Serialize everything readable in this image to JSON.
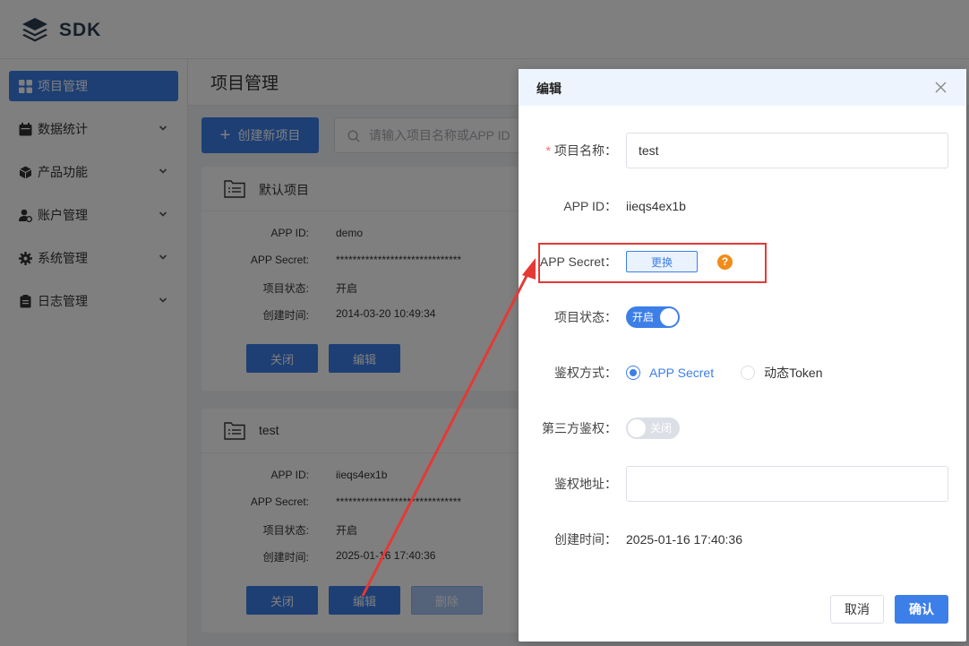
{
  "app": {
    "brand": "SDK"
  },
  "sidebar": {
    "items": [
      {
        "label": "项目管理",
        "icon": "grid-icon",
        "active": true
      },
      {
        "label": "数据统计",
        "icon": "calendar-icon"
      },
      {
        "label": "产品功能",
        "icon": "cube-icon"
      },
      {
        "label": "账户管理",
        "icon": "user-gear-icon"
      },
      {
        "label": "系统管理",
        "icon": "gear-icon"
      },
      {
        "label": "日志管理",
        "icon": "clipboard-icon"
      }
    ]
  },
  "main": {
    "title": "项目管理",
    "create_label": "创建新项目",
    "search_placeholder": "请输入项目名称或APP ID",
    "cards": [
      {
        "name": "默认项目",
        "fields": [
          {
            "label": "APP ID:",
            "value": "demo"
          },
          {
            "label": "APP Secret:",
            "value": "******************************"
          },
          {
            "label": "项目状态:",
            "value": "开启"
          },
          {
            "label": "创建时间:",
            "value": "2014-03-20 10:49:34"
          }
        ],
        "buttons": [
          "关闭",
          "编辑"
        ]
      },
      {
        "name": "test",
        "fields": [
          {
            "label": "APP ID:",
            "value": "iieqs4ex1b"
          },
          {
            "label": "APP Secret:",
            "value": "******************************"
          },
          {
            "label": "项目状态:",
            "value": "开启"
          },
          {
            "label": "创建时间:",
            "value": "2025-01-16 17:40:36"
          }
        ],
        "buttons": [
          "关闭",
          "编辑",
          "删除"
        ]
      }
    ]
  },
  "dialog": {
    "title": "编辑",
    "name_label": "项目名称：",
    "name_value": "test",
    "appid_label": "APP ID：",
    "appid_value": "iieqs4ex1b",
    "secret_label": "APP Secret：",
    "change_label": "更换",
    "help_glyph": "?",
    "status_label": "项目状态：",
    "status_switch": "开启",
    "auth_label": "鉴权方式：",
    "auth_options": [
      "APP Secret",
      "动态Token"
    ],
    "auth_selected": "APP Secret",
    "third_label": "第三方鉴权：",
    "third_switch": "关闭",
    "auth_url_label": "鉴权地址：",
    "auth_url_value": "",
    "created_label": "创建时间：",
    "created_value": "2025-01-16 17:40:36",
    "cancel_label": "取消",
    "confirm_label": "确认"
  },
  "colors": {
    "primary": "#3d7fe8",
    "annotation": "#e53935",
    "help": "#f08c1a"
  }
}
